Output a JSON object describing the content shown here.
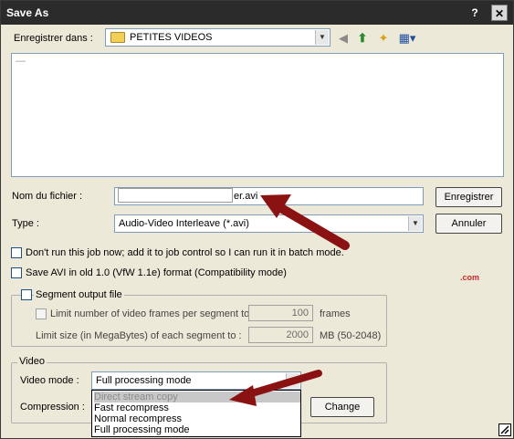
{
  "window": {
    "title": "Save As",
    "help_glyph": "?",
    "close_glyph": "✕"
  },
  "location": {
    "label": "Enregistrer dans :",
    "value": "PETITES VIDEOS"
  },
  "toolbar_icons": [
    "back-icon",
    "up-folder-icon",
    "new-folder-icon",
    "view-menu-icon"
  ],
  "filelist": {
    "dash": "—"
  },
  "filename": {
    "label": "Nom du fichier :",
    "value": "er.avi"
  },
  "filetype": {
    "label": "Type :",
    "value": "Audio-Video Interleave (*.avi)"
  },
  "buttons": {
    "save": "Enregistrer",
    "cancel": "Annuler",
    "change": "Change"
  },
  "options": {
    "batch": "Don't run this job now; add it to job control so I can run it in batch mode.",
    "compat": "Save AVI in old 1.0 (VfW 1.1e) format (Compatibility mode)"
  },
  "segment": {
    "legend": "Segment output file",
    "limit_frames_label": "Limit number of video frames per segment to",
    "frames_value": "100",
    "frames_unit": "frames",
    "limit_size_label": "Limit size (in MegaBytes) of each segment to :",
    "size_value": "2000",
    "size_unit": "MB (50-2048)"
  },
  "watermark": ".com",
  "video": {
    "legend": "Video",
    "mode_label": "Video mode :",
    "mode_value": "Full processing mode",
    "compression_label": "Compression :",
    "mode_options": [
      "Direct stream copy",
      "Fast recompress",
      "Normal recompress",
      "Full processing mode"
    ]
  },
  "annotation_color": "#8b1212"
}
